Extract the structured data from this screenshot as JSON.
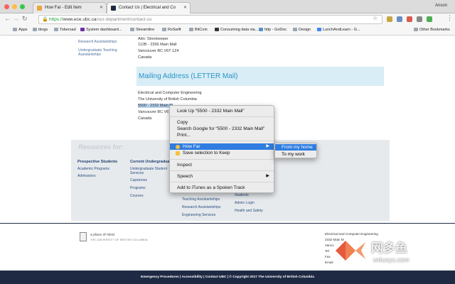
{
  "tabs": [
    {
      "label": "How Far - Edit Item",
      "active": false
    },
    {
      "label": "Contact Us | Electrical and Co",
      "active": true
    }
  ],
  "user": "Anson",
  "url": {
    "scheme": "https://",
    "host": "www.ece.ubc.ca",
    "path": "/our-department/contact-us"
  },
  "bookmarks": [
    {
      "label": "Apps",
      "icon": "apps-icon"
    },
    {
      "label": "blogs",
      "icon": "folder-icon"
    },
    {
      "label": "Tobersad",
      "icon": "folder-icon"
    },
    {
      "label": "System dashboard...",
      "icon": "yahoo-icon"
    },
    {
      "label": "Streamline",
      "icon": "folder-icon"
    },
    {
      "label": "RxSwift",
      "icon": "folder-icon"
    },
    {
      "label": "BitCoin",
      "icon": "folder-icon"
    },
    {
      "label": "Consuming data via...",
      "icon": "page-icon"
    },
    {
      "label": "http - GoDoc",
      "icon": "page-icon"
    },
    {
      "label": "Design",
      "icon": "folder-icon"
    },
    {
      "label": "LunchAndLearn - G...",
      "icon": "page-icon"
    },
    {
      "label": "Other Bookmarks",
      "icon": "folder-icon"
    }
  ],
  "sidebar": [
    "Research Assistantships",
    "Undergraduate Teaching Assistantships"
  ],
  "address_top": [
    "Attn: Storekeeper",
    "112B - 2356 Main Mall",
    "Vancouver BC V6T 1Z4",
    "Canada"
  ],
  "mailing_title": "Mailing Address (LETTER Mail)",
  "mailing": [
    "Electrical and Computer Engineering",
    "The University of British Columbia",
    "5500 - 2332 Main M",
    "Vancouver BC V6T",
    "Canada"
  ],
  "footer": {
    "resources": "Resources for:",
    "prospective": {
      "title": "Prospective Students",
      "links": [
        "Academic Programs",
        "Admissions"
      ]
    },
    "current": {
      "title": "Current Undergraduate",
      "links": [
        "Undergraduate Student Services",
        "Capstones",
        "Programs",
        "Courses"
      ]
    },
    "col3": [
      "Teaching Assistantships",
      "Research Assistantships",
      "Engineering Services"
    ],
    "col4": [
      "Students",
      "Admin Login",
      "Health and Safety"
    ]
  },
  "ubc": {
    "tagline": "a place of mind",
    "name": "THE UNIVERSITY OF BRITISH COLUMBIA"
  },
  "contact_block": [
    "Electrical and Computer Engineering",
    "2332 Main M",
    "Vanco",
    "Tel",
    "Fax",
    "Email"
  ],
  "bottom_links": "Emergency Procedures | Accessibility | Contact UBC | © Copyright 2017 The University of British Columbia",
  "context_menu": {
    "lookup": "Look Up “5500 - 2332 Main Mall”",
    "copy": "Copy",
    "search": "Search Google for “5500 - 2332 Main Mall”",
    "print": "Print...",
    "howfar": "How Far",
    "save": "Save selection to Keep",
    "inspect": "Inspect",
    "speech": "Speech",
    "itunes": "Add to iTunes as a Spoken Track"
  },
  "submenu": [
    "From my home",
    "To my work"
  ],
  "watermark": {
    "cn": "网多鱼",
    "url": "wduoyu.com"
  },
  "colors": {
    "accent": "#2f7de1",
    "ubc_blue": "#1e2a44",
    "heading_blue": "#2a93c9"
  }
}
